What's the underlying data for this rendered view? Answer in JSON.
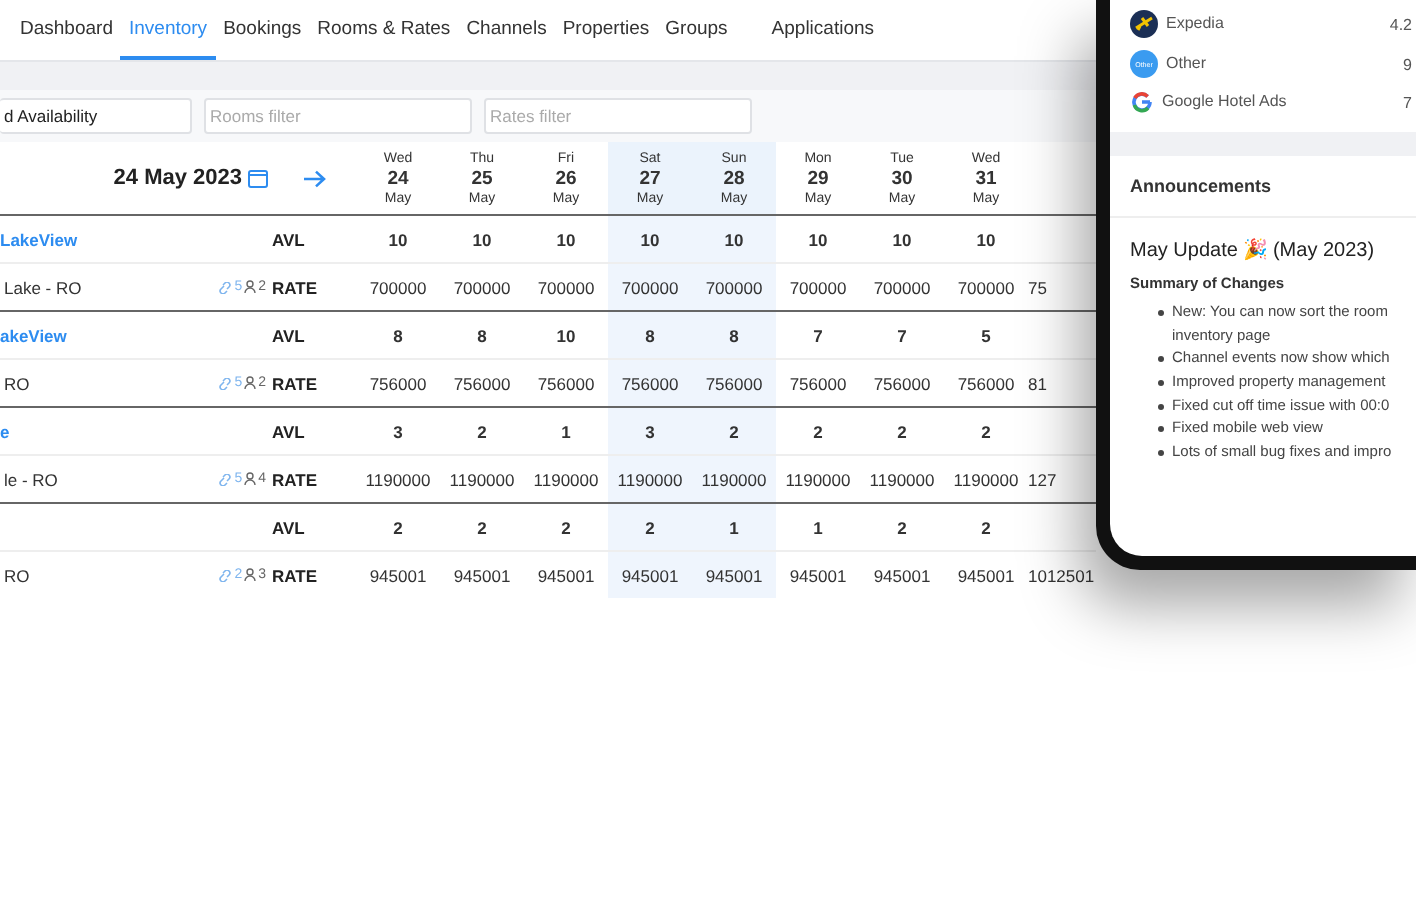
{
  "nav": [
    {
      "label": "Dashboard",
      "selected": false
    },
    {
      "label": "Inventory",
      "selected": true
    },
    {
      "label": "Bookings",
      "selected": false
    },
    {
      "label": "Rooms & Rates",
      "selected": false
    },
    {
      "label": "Channels",
      "selected": false
    },
    {
      "label": "Properties",
      "selected": false
    },
    {
      "label": "Groups",
      "selected": false
    },
    {
      "label": "Applications",
      "selected": false
    }
  ],
  "filters": {
    "view_value": "d Availability",
    "rooms_placeholder": "Rooms filter",
    "rates_placeholder": "Rates filter"
  },
  "date_label": "24 May 2023",
  "days": [
    {
      "weekday": "Wed",
      "day": "24",
      "month": "May",
      "weekend": false
    },
    {
      "weekday": "Thu",
      "day": "25",
      "month": "May",
      "weekend": false
    },
    {
      "weekday": "Fri",
      "day": "26",
      "month": "May",
      "weekend": false
    },
    {
      "weekday": "Sat",
      "day": "27",
      "month": "May",
      "weekend": true
    },
    {
      "weekday": "Sun",
      "day": "28",
      "month": "May",
      "weekend": true
    },
    {
      "weekday": "Mon",
      "day": "29",
      "month": "May",
      "weekend": false
    },
    {
      "weekday": "Tue",
      "day": "30",
      "month": "May",
      "weekend": false
    },
    {
      "weekday": "Wed",
      "day": "31",
      "month": "May",
      "weekend": false
    }
  ],
  "rooms": [
    {
      "name": "LakeView",
      "avl_label": "AVL",
      "avl": [
        "10",
        "10",
        "10",
        "10",
        "10",
        "10",
        "10",
        "10"
      ],
      "rate_name": "Lake - RO",
      "links": "5",
      "occupancy": "2",
      "rate_label": "RATE",
      "rates": [
        "700000",
        "700000",
        "700000",
        "700000",
        "700000",
        "700000",
        "700000",
        "700000"
      ],
      "rate_cut": "75"
    },
    {
      "name": "akeView",
      "avl_label": "AVL",
      "avl": [
        "8",
        "8",
        "10",
        "8",
        "8",
        "7",
        "7",
        "5"
      ],
      "rate_name": "RO",
      "links": "5",
      "occupancy": "2",
      "rate_label": "RATE",
      "rates": [
        "756000",
        "756000",
        "756000",
        "756000",
        "756000",
        "756000",
        "756000",
        "756000"
      ],
      "rate_cut": "81"
    },
    {
      "name": "e",
      "avl_label": "AVL",
      "avl": [
        "3",
        "2",
        "1",
        "3",
        "2",
        "2",
        "2",
        "2"
      ],
      "rate_name": "le - RO",
      "links": "5",
      "occupancy": "4",
      "rate_label": "RATE",
      "rates": [
        "1190000",
        "1190000",
        "1190000",
        "1190000",
        "1190000",
        "1190000",
        "1190000",
        "1190000"
      ],
      "rate_cut": "127"
    },
    {
      "avl_label": "AVL",
      "avl": [
        "2",
        "2",
        "2",
        "2",
        "1",
        "1",
        "2",
        "2"
      ],
      "rate_name": "RO",
      "links": "2",
      "occupancy": "3",
      "rate_label": "RATE",
      "rates": [
        "945001",
        "945001",
        "945001",
        "945001",
        "945001",
        "945001",
        "945001",
        "945001"
      ],
      "rate_cut": "1012501"
    }
  ],
  "phone": {
    "channels": [
      {
        "name": "Expedia",
        "value": "4.2",
        "kind": "plane"
      },
      {
        "name": "Other",
        "value": "9",
        "kind": "other"
      },
      {
        "name": "Google Hotel Ads",
        "value": "7",
        "kind": "google"
      }
    ],
    "badge_other": "Other",
    "announcements_title": "Announcements",
    "update_title": "May Update 🎉 (May 2023)",
    "summary_title": "Summary of Changes",
    "changes": [
      "New: You can now sort the room inventory page",
      "Channel events now show which",
      "Improved property management",
      "Fixed cut off time issue with 00:0",
      "Fixed mobile web view",
      "Lots of small bug fixes and impro"
    ]
  }
}
